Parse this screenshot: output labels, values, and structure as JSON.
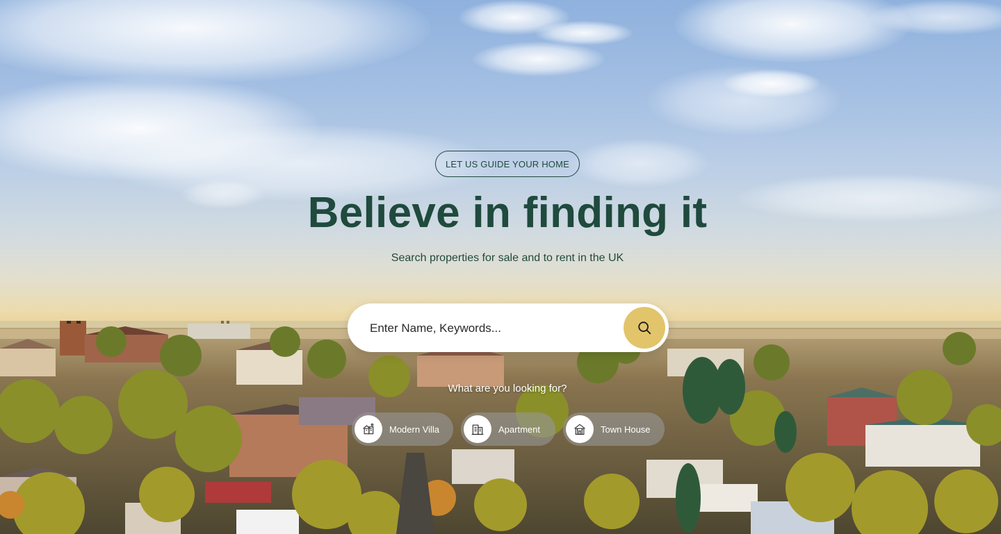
{
  "hero": {
    "tag_label": "LET US GUIDE YOUR HOME",
    "headline": "Believe in finding it",
    "subtitle": "Search properties for sale and to rent in the UK"
  },
  "search": {
    "placeholder": "Enter Name, Keywords...",
    "button_icon": "search-icon"
  },
  "categories": {
    "prompt": "What are you looking for?",
    "items": [
      {
        "label": "Modern Villa",
        "icon": "villa-icon"
      },
      {
        "label": "Apartment",
        "icon": "apartment-icon"
      },
      {
        "label": "Town House",
        "icon": "town-house-icon"
      }
    ]
  },
  "colors": {
    "brand_green": "#1f4a3d",
    "accent_gold": "#e2c46a"
  }
}
